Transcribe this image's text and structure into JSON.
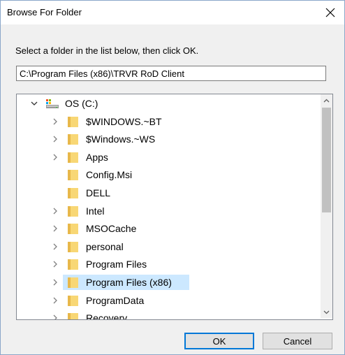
{
  "window": {
    "title": "Browse For Folder",
    "close_glyph": "✕"
  },
  "instruction": "Select a folder in the list below, then click OK.",
  "path_field": {
    "value": "C:\\Program Files (x86)\\TRVR RoD Client"
  },
  "tree": {
    "root": {
      "label": "OS (C:)",
      "icon": "drive-icon",
      "expanded": true
    },
    "items": [
      {
        "label": "$WINDOWS.~BT",
        "expandable": true
      },
      {
        "label": "$Windows.~WS",
        "expandable": true
      },
      {
        "label": "Apps",
        "expandable": true
      },
      {
        "label": "Config.Msi",
        "expandable": false
      },
      {
        "label": "DELL",
        "expandable": false
      },
      {
        "label": "Intel",
        "expandable": true
      },
      {
        "label": "MSOCache",
        "expandable": true
      },
      {
        "label": "personal",
        "expandable": true
      },
      {
        "label": "Program Files",
        "expandable": true
      },
      {
        "label": "Program Files (x86)",
        "expandable": true,
        "selected": true
      },
      {
        "label": "ProgramData",
        "expandable": true
      },
      {
        "label": "Recovery",
        "expandable": true
      }
    ]
  },
  "buttons": {
    "ok": "OK",
    "cancel": "Cancel"
  },
  "colors": {
    "selection": "#cce8ff",
    "folder": "#f8d775",
    "accent": "#0078d7"
  }
}
